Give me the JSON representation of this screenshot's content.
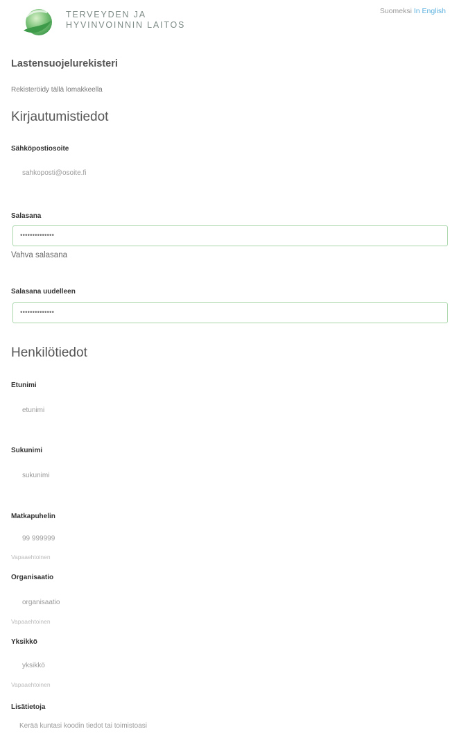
{
  "header": {
    "org_line1": "TERVEYDEN JA",
    "org_line2": "HYVINVOINNIN LAITOS",
    "lang_current": "Suomeksi",
    "lang_other": "In English"
  },
  "page": {
    "register_title": "Lastensuojelurekisteri",
    "intro": "Rekisteröidy tällä lomakkeella"
  },
  "login": {
    "section_title": "Kirjautumistiedot",
    "email_label": "Sähköpostiosoite",
    "email_value": "sahkoposti@osoite.fi",
    "password_label": "Salasana",
    "password_value": "••••••••••••••",
    "password_strength": "Vahva salasana",
    "password_repeat_label": "Salasana uudelleen",
    "password_repeat_value": "••••••••••••••"
  },
  "personal": {
    "section_title": "Henkilötiedot",
    "firstname_label": "Etunimi",
    "firstname_value": "etunimi",
    "lastname_label": "Sukunimi",
    "lastname_value": "sukunimi",
    "phone_label": "Matkapuhelin",
    "phone_value": "99 999999",
    "phone_help": "Vapaaehtoinen",
    "org_label": "Organisaatio",
    "org_value": "organisaatio",
    "org_help": "Vapaaehtoinen",
    "unit_label": "Yksikkö",
    "unit_value": "yksikkö",
    "unit_help": "Vapaaehtoinen",
    "extra_label": "Lisätietoja",
    "extra_value": "Kerää kuntasi koodin tiedot tai toimistoasi"
  },
  "colors": {
    "accent_green": "#7cc37a",
    "link_blue": "#5ab0de",
    "input_border": "#a6d6a8"
  },
  "icons": {
    "logo": "thl-globe-logo"
  }
}
